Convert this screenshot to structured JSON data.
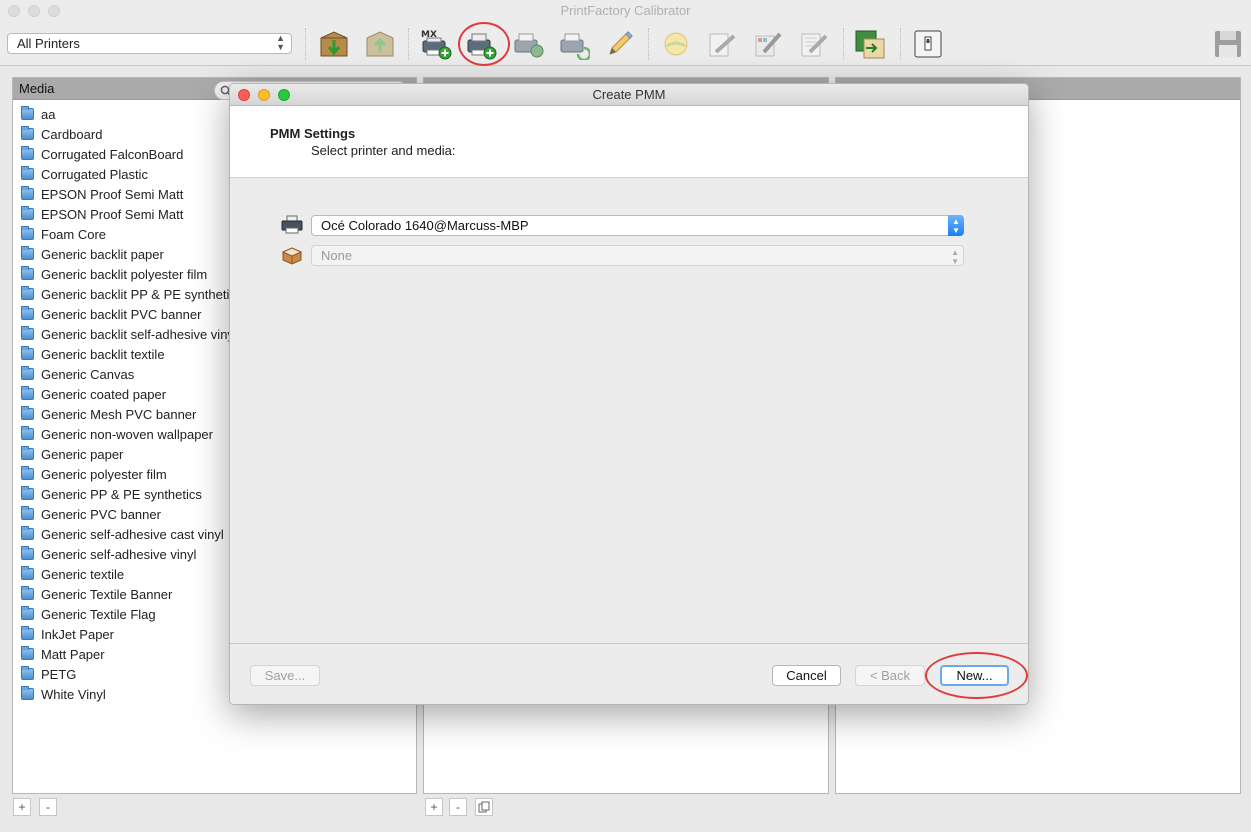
{
  "window": {
    "title": "PrintFactory Calibrator"
  },
  "toolbar": {
    "printer_filter": "All Printers",
    "icons": [
      "import-icon",
      "export-icon",
      "mx-printer-add-icon",
      "printer-add-icon",
      "printer-settings-icon",
      "printer-refresh-icon",
      "pencil-icon",
      "sun-icon",
      "measure-icon",
      "measure-chart-icon",
      "measure-edit-icon",
      "spot-color-icon",
      "device-icon",
      "save-disk-icon"
    ]
  },
  "media_pane": {
    "header": "Media",
    "items": [
      "aa",
      "Cardboard",
      "Corrugated FalconBoard",
      "Corrugated Plastic",
      "EPSON Proof Semi Matt",
      "EPSON Proof Semi Matt",
      "Foam Core",
      "Generic backlit paper",
      "Generic backlit polyester film",
      "Generic backlit PP & PE synthetics",
      "Generic backlit PVC banner",
      "Generic backlit self-adhesive vinyl",
      "Generic backlit textile",
      "Generic Canvas",
      "Generic coated paper",
      "Generic Mesh PVC banner",
      "Generic non-woven wallpaper",
      "Generic paper",
      "Generic polyester film",
      "Generic PP & PE synthetics",
      "Generic PVC banner",
      "Generic self-adhesive cast vinyl",
      "Generic self-adhesive vinyl",
      "Generic textile",
      "Generic Textile Banner",
      "Generic Textile Flag",
      "InkJet Paper",
      "Matt Paper",
      "PETG",
      "White Vinyl"
    ]
  },
  "bottom_buttons": {
    "add": "+",
    "remove": "-"
  },
  "dialog": {
    "title": "Create PMM",
    "heading": "PMM Settings",
    "subheading": "Select printer and media:",
    "printer_value": "Océ Colorado 1640@Marcuss-MBP",
    "media_value": "None",
    "save_label": "Save...",
    "cancel_label": "Cancel",
    "back_label": "< Back",
    "new_label": "New..."
  },
  "colors": {
    "annotation_red": "#e03b3b",
    "accent_blue": "#1a7ff5"
  }
}
